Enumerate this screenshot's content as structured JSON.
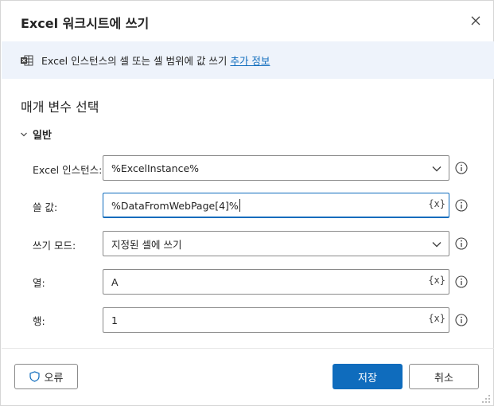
{
  "dialog": {
    "title": "Excel 워크시트에 쓰기",
    "close_icon": "close-icon"
  },
  "banner": {
    "text": "Excel 인스턴스의 셀 또는 셀 범위에 값 쓰기",
    "link": "추가 정보",
    "icon": "excel-icon"
  },
  "section": {
    "title": "매개 변수 선택",
    "group_label": "일반"
  },
  "fields": {
    "instance": {
      "label": "Excel 인스턴스:",
      "value": "%ExcelInstance%"
    },
    "value": {
      "label": "쓸 값:",
      "value": "%DataFromWebPage[4]%",
      "var_button": "{x}"
    },
    "mode": {
      "label": "쓰기 모드:",
      "value": "지정된 셀에 쓰기"
    },
    "column": {
      "label": "열:",
      "value": "A",
      "var_button": "{x}"
    },
    "row": {
      "label": "행:",
      "value": "1",
      "var_button": "{x}"
    }
  },
  "footer": {
    "error_label": "오류",
    "save_label": "저장",
    "cancel_label": "취소"
  },
  "colors": {
    "accent": "#0f6cbd",
    "banner_bg": "#eef3fb"
  }
}
